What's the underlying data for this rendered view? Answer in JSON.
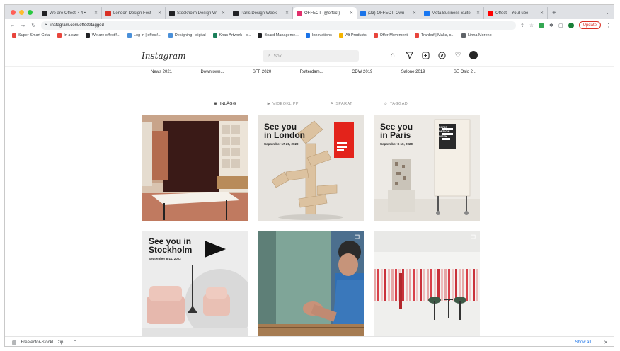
{
  "browser": {
    "tabs": [
      {
        "title": "We are Offect! • 4 •",
        "color": "#202124",
        "active": false
      },
      {
        "title": "London Design Fest",
        "color": "#d93025",
        "active": false
      },
      {
        "title": "Stockholm Design W",
        "color": "#202124",
        "active": false
      },
      {
        "title": "Paris Design Week",
        "color": "#202124",
        "active": false
      },
      {
        "title": "OFFECT (@offect)",
        "color": "#e1306c",
        "active": true
      },
      {
        "title": "(23) OFFECT: Own",
        "color": "#1a73e8",
        "active": false
      },
      {
        "title": "Meta Business Suite",
        "color": "#1877f2",
        "active": false
      },
      {
        "title": "Offect! - YouTube",
        "color": "#ff0000",
        "active": false
      }
    ],
    "new_tab": "+",
    "tab_menu": "⌄",
    "url": "instagram.com/offect/tagged",
    "update_label": "Update",
    "bookmarks": [
      {
        "label": "Super Smart Cofal",
        "color": "#e8453c"
      },
      {
        "label": "In a size",
        "color": "#e8453c"
      },
      {
        "label": "We are offect!!...",
        "color": "#202124"
      },
      {
        "label": "Log in | offect!...",
        "color": "#4a90d9"
      },
      {
        "label": "Designing - digital",
        "color": "#4a90d9"
      },
      {
        "label": "Knas Artwork - b...",
        "color": "#1a7f5a"
      },
      {
        "label": "Board Manageme...",
        "color": "#202124"
      },
      {
        "label": "Innovations",
        "color": "#1a73e8"
      },
      {
        "label": "Alt Products",
        "color": "#f5b400"
      },
      {
        "label": "Offer Movement",
        "color": "#e8453c"
      },
      {
        "label": "Tranbuf | Malta, s...",
        "color": "#e8453c"
      },
      {
        "label": "Linna Moreno",
        "color": "#5f6368"
      }
    ]
  },
  "instagram": {
    "logo": "Instagram",
    "search_placeholder": "Sök",
    "highlights": [
      "News 2021",
      "Downtown...",
      "SFF 2020",
      "Rotterdam...",
      "CDW 2019",
      "Salone 2019",
      "SE Oslo 2..."
    ],
    "tabs": [
      {
        "label": "INLÄGG",
        "active": true
      },
      {
        "label": "VIDEOKLIPP",
        "active": false
      },
      {
        "label": "SPARAT",
        "active": false
      },
      {
        "label": "TAGGAD",
        "active": false
      }
    ],
    "posts": [
      {
        "title": "",
        "subtitle": ""
      },
      {
        "title": "See you\nin London",
        "subtitle": "September 17-20, 2020"
      },
      {
        "title": "See you\nin Paris",
        "subtitle": "September 8-10, 2020",
        "badge": "PARIS DESIGN WEEK"
      },
      {
        "title": "See you in\nStockholm",
        "subtitle": "September 8-11, 2022"
      },
      {
        "title": "",
        "subtitle": ""
      },
      {
        "title": "",
        "subtitle": ""
      }
    ]
  },
  "downloads": {
    "file": "Freelector-Stockl....zip",
    "show_all": "Show all"
  },
  "colors": {
    "accent": "#e1306c",
    "update_red": "#d93025",
    "traffic_red": "#ff5f57",
    "traffic_yellow": "#febc2e",
    "traffic_green": "#28c840"
  }
}
